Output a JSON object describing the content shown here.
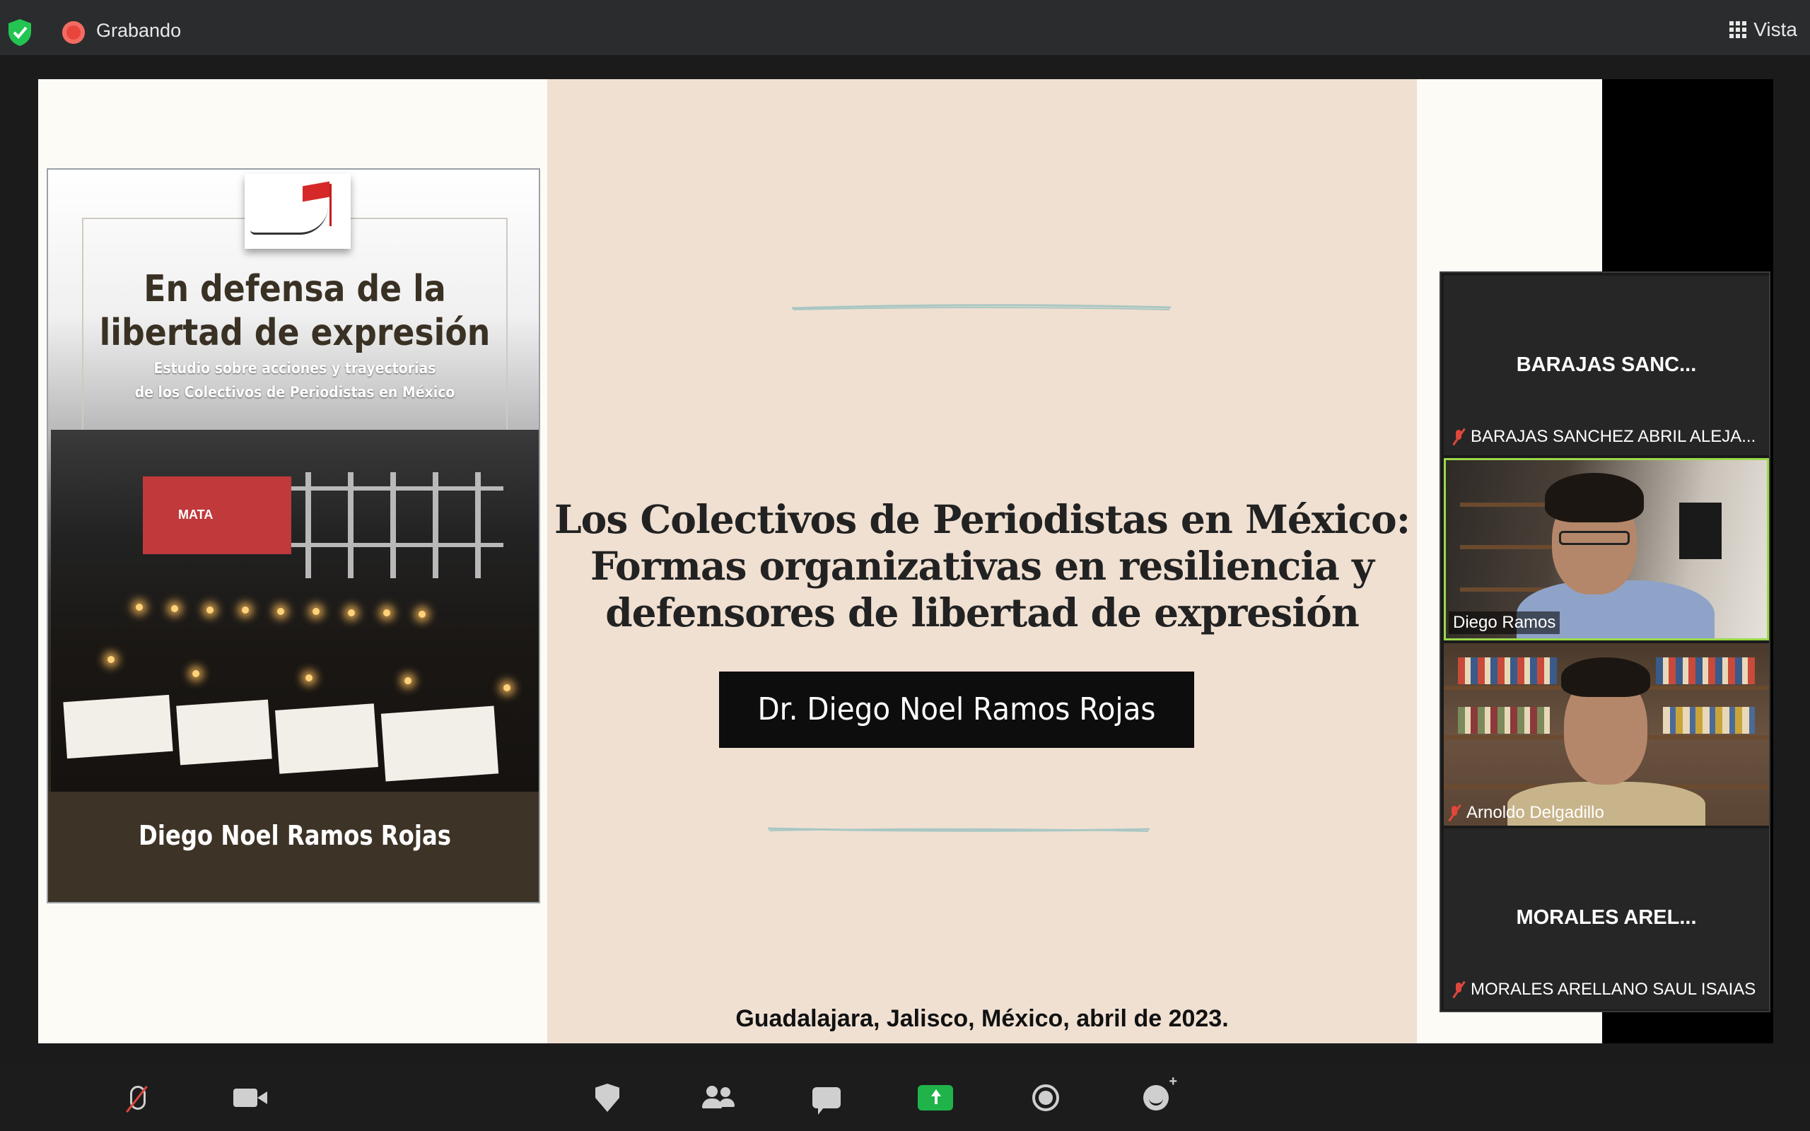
{
  "topbar": {
    "security_icon": "shield-check-icon",
    "recording_label": "Grabando",
    "view_label": "Vista",
    "view_icon": "grid-icon"
  },
  "slide": {
    "book": {
      "title": "En defensa de la libertad de expresión",
      "subtitle_line1": "Estudio sobre acciones y trayectorias",
      "subtitle_line2": "de los Colectivos de Periodistas en México",
      "author": "Diego Noel Ramos Rojas",
      "banner_text": "MATA"
    },
    "title_line1": "Los Colectivos de Periodistas en México:",
    "title_line2": "Formas organizativas en resiliencia y",
    "title_line3": "defensores de libertad de expresión",
    "presenter": "Dr. Diego Noel Ramos Rojas",
    "place_date": "Guadalajara, Jalisco, México, abril de 2023.",
    "colors": {
      "panel": "#f0e0d2",
      "deco_line": "#a9c7c3",
      "name_box": "#0d0d0d"
    }
  },
  "participants": [
    {
      "display_name": "BARAJAS SANC...",
      "full_name": "BARAJAS SANCHEZ ABRIL ALEJA...",
      "muted": true,
      "video": false
    },
    {
      "full_name": "Diego Ramos",
      "muted": false,
      "video": true,
      "active_speaker": true
    },
    {
      "full_name": "Arnoldo Delgadillo",
      "muted": true,
      "video": true
    },
    {
      "display_name": "MORALES AREL...",
      "full_name": "MORALES ARELLANO SAUL ISAIAS",
      "muted": true,
      "video": false
    }
  ],
  "toolbar": {
    "buttons": [
      {
        "name": "mute",
        "icon": "mic-muted-icon"
      },
      {
        "name": "video",
        "icon": "video-camera-icon"
      },
      {
        "name": "security",
        "icon": "shield-icon"
      },
      {
        "name": "participants",
        "icon": "participants-icon"
      },
      {
        "name": "chat",
        "icon": "chat-icon"
      },
      {
        "name": "share-screen",
        "icon": "share-screen-icon",
        "color": "#1fb34a"
      },
      {
        "name": "record",
        "icon": "record-icon"
      },
      {
        "name": "reactions",
        "icon": "reactions-icon"
      }
    ]
  }
}
